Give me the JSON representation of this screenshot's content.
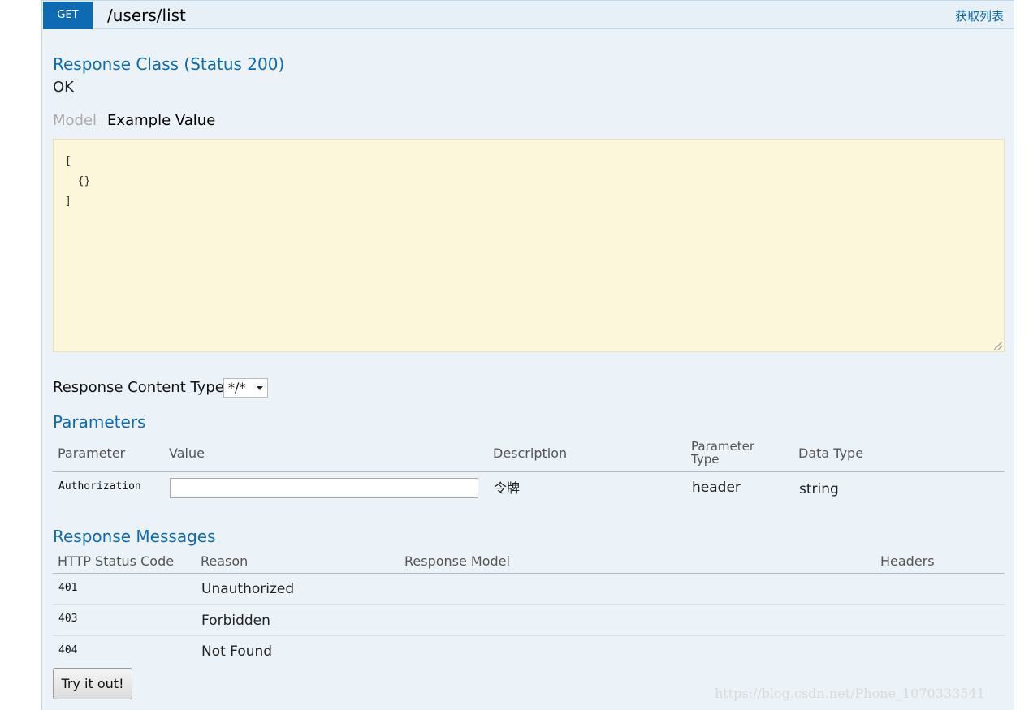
{
  "operation": {
    "method": "GET",
    "path": "/users/list",
    "summary": "获取列表"
  },
  "response_class": {
    "title": "Response Class (Status 200)",
    "status_text": "OK",
    "tabs": {
      "model": "Model",
      "example": "Example Value"
    },
    "example_value": "[\n  {}\n]"
  },
  "content_type": {
    "label": "Response Content Type",
    "selected": "*/*"
  },
  "parameters": {
    "title": "Parameters",
    "headers": {
      "parameter": "Parameter",
      "value": "Value",
      "description": "Description",
      "param_type_line1": "Parameter",
      "param_type_line2": "Type",
      "data_type": "Data Type"
    },
    "rows": [
      {
        "name": "Authorization",
        "value": "",
        "description": "令牌",
        "param_type": "header",
        "data_type": "string"
      }
    ]
  },
  "response_messages": {
    "title": "Response Messages",
    "headers": {
      "status_code": "HTTP Status Code",
      "reason": "Reason",
      "model": "Response Model",
      "headers": "Headers"
    },
    "rows": [
      {
        "code": "401",
        "reason": "Unauthorized"
      },
      {
        "code": "403",
        "reason": "Forbidden"
      },
      {
        "code": "404",
        "reason": "Not Found"
      }
    ]
  },
  "try_button": "Try it out!",
  "watermark": "https://blog.csdn.net/Phone_1070333541",
  "colors": {
    "get_method": "#0f6ab4",
    "panel_bg": "#ebf3f9",
    "example_bg": "#fcf6db"
  }
}
